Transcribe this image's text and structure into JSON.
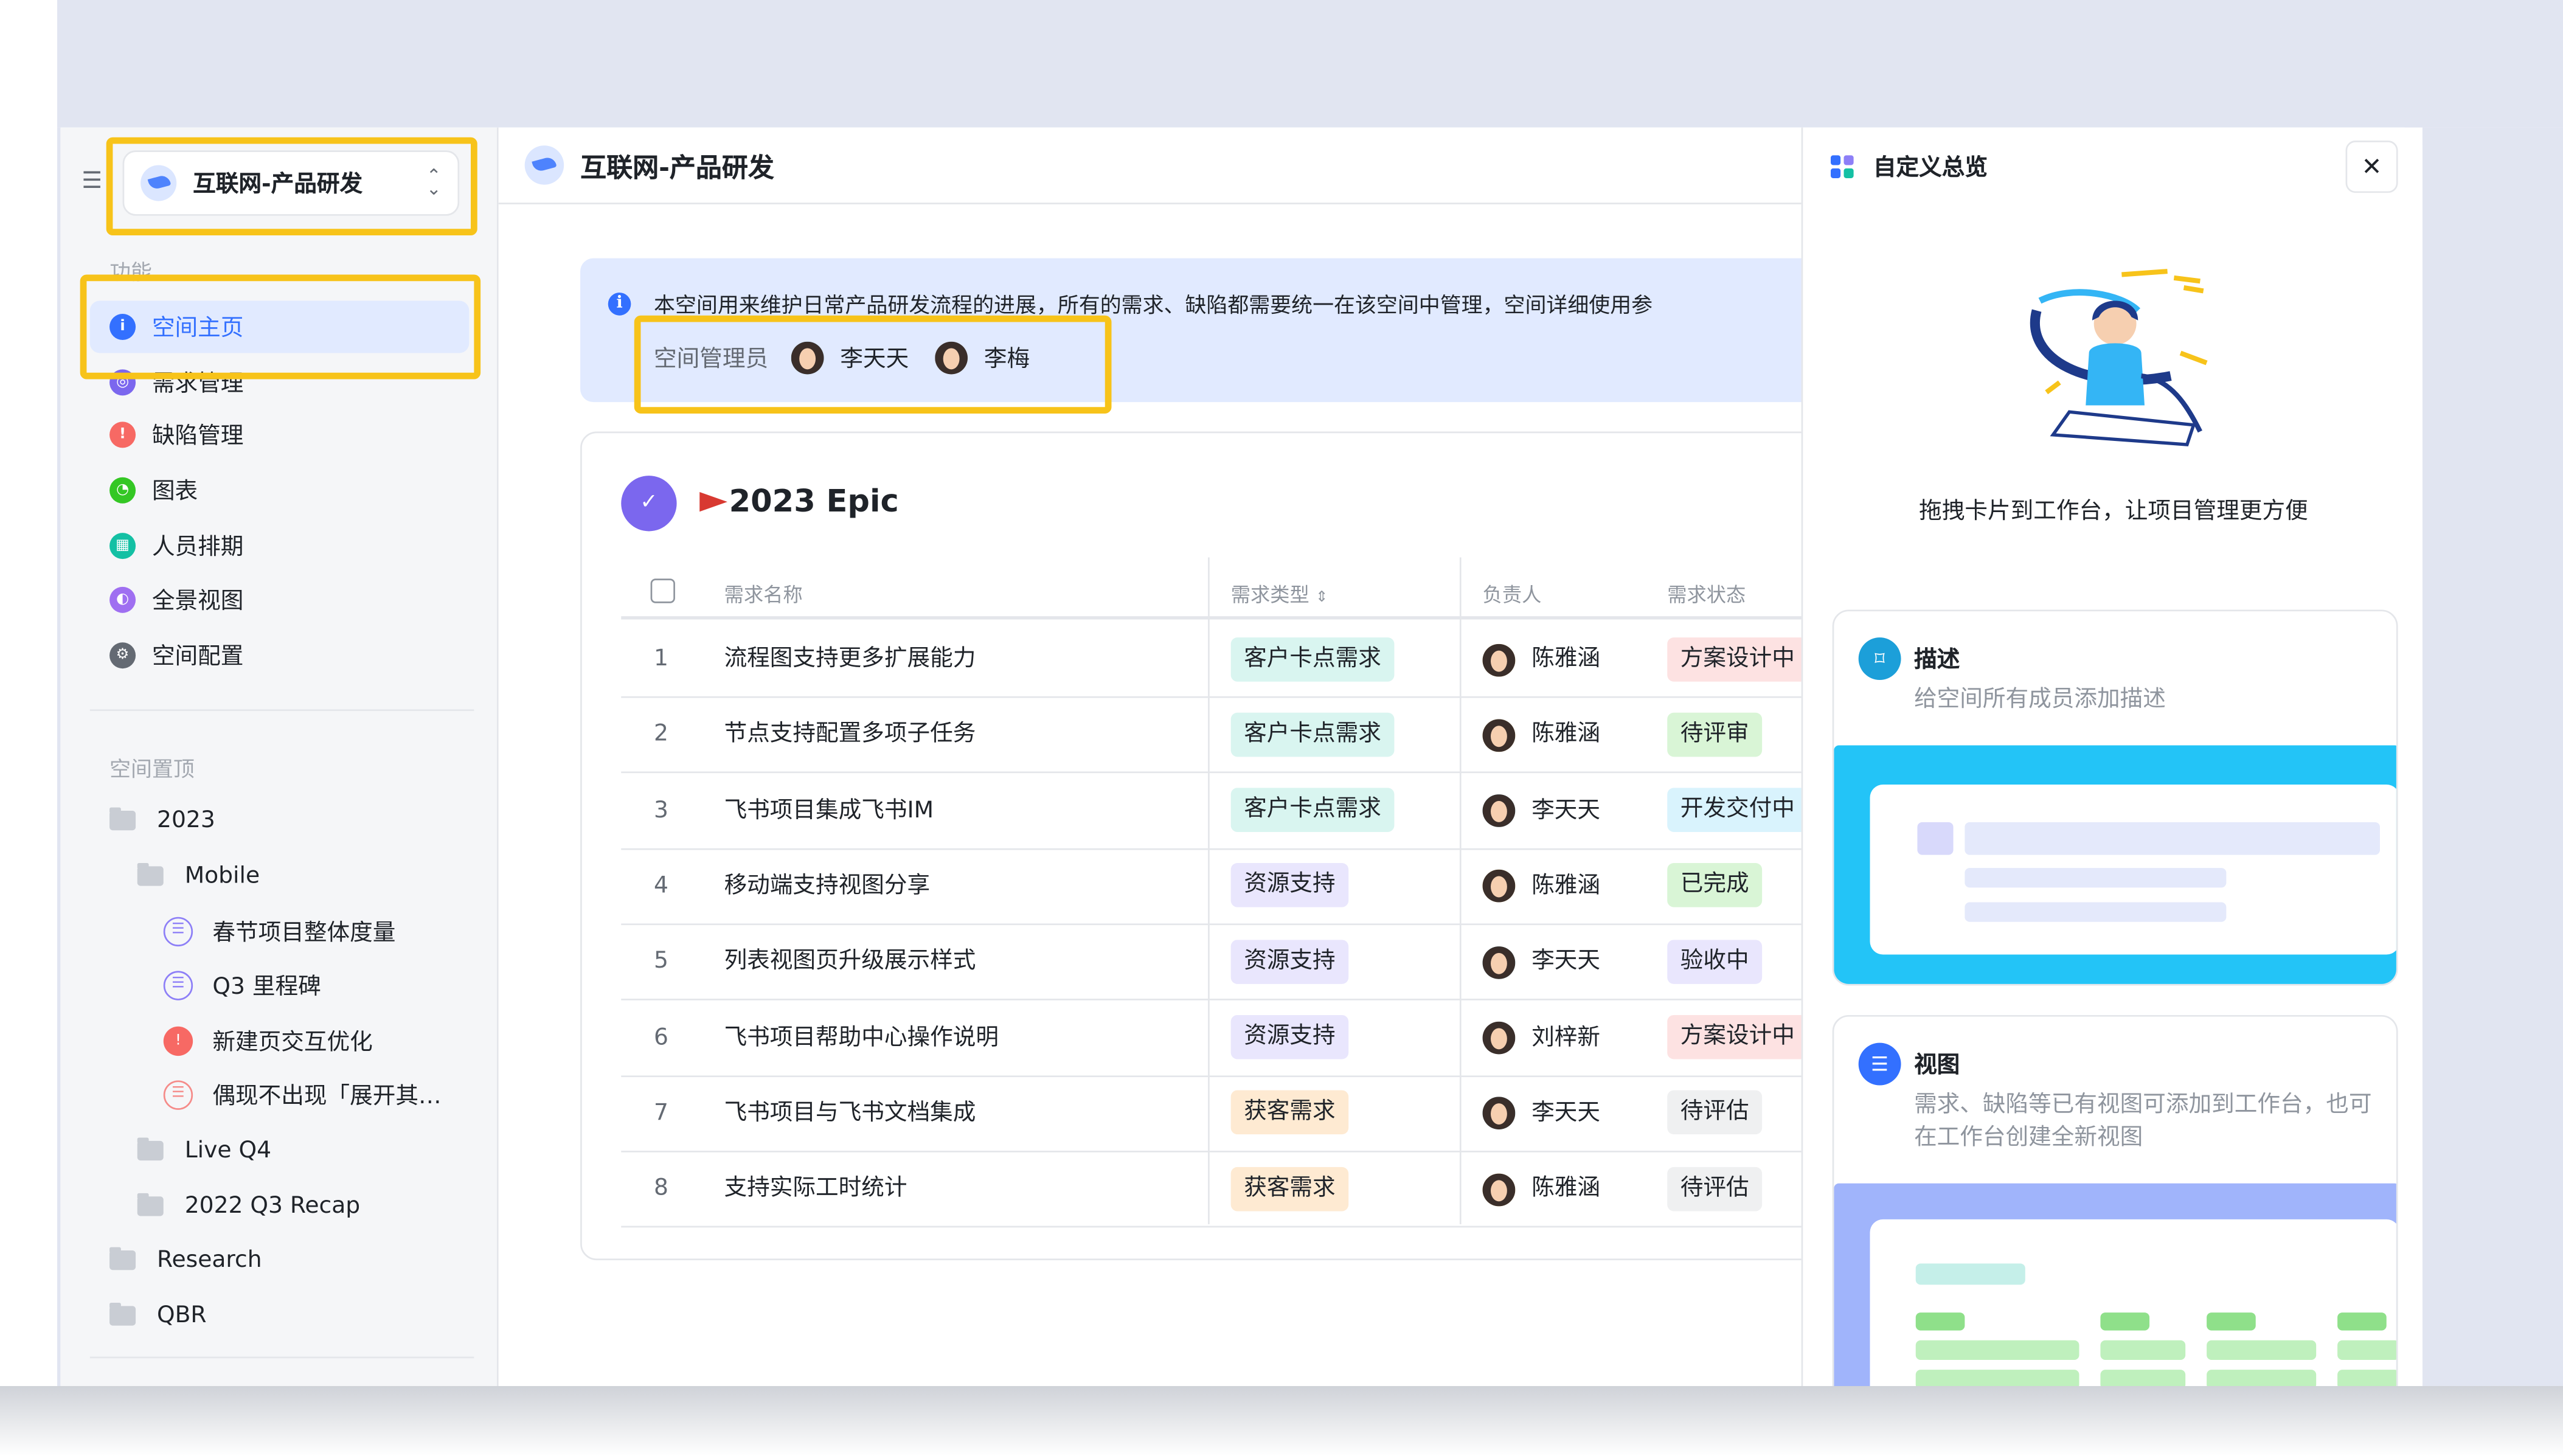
{
  "sidebar": {
    "space_name": "互联网-产品研发",
    "section_features": "功能",
    "nav": [
      {
        "label": "空间主页",
        "icon": "home-icon",
        "color": "#3370ff"
      },
      {
        "label": "需求管理",
        "icon": "requirement-icon",
        "color": "#7b67ee"
      },
      {
        "label": "缺陷管理",
        "icon": "bug-icon",
        "color": "#f76964"
      },
      {
        "label": "图表",
        "icon": "chart-icon",
        "color": "#34c724"
      },
      {
        "label": "人员排期",
        "icon": "schedule-icon",
        "color": "#14c0a4"
      },
      {
        "label": "全景视图",
        "icon": "panorama-icon",
        "color": "#9f6ff1"
      },
      {
        "label": "空间配置",
        "icon": "settings-icon",
        "color": "#646a73"
      }
    ],
    "section_pinned": "空间置顶",
    "tree": [
      {
        "label": "2023",
        "type": "folder"
      },
      {
        "label": "Mobile",
        "type": "folder"
      },
      {
        "label": "春节项目整体度量",
        "type": "view"
      },
      {
        "label": "Q3 里程碑",
        "type": "view"
      },
      {
        "label": "新建页交互优化",
        "type": "bug"
      },
      {
        "label": "偶现不出现「展开其…",
        "type": "view-pink"
      },
      {
        "label": "Live Q4",
        "type": "folder"
      },
      {
        "label": "2022 Q3 Recap",
        "type": "folder"
      },
      {
        "label": "Research",
        "type": "folder"
      },
      {
        "label": "QBR",
        "type": "folder"
      }
    ]
  },
  "main": {
    "title": "互联网-产品研发",
    "notice_text": "本空间用来维护日常产品研发流程的进展，所有的需求、缺陷都需要统一在该空间中管理，空间详细使用参",
    "admin_label": "空间管理员",
    "admins": [
      "李天天",
      "李梅"
    ],
    "epic_title": "2023 Epic",
    "columns": [
      "需求名称",
      "需求类型",
      "负责人",
      "需求状态"
    ],
    "rows": [
      {
        "idx": "1",
        "name": "流程图支持更多扩展能力",
        "type": "客户卡点需求",
        "owner": "陈雅涵",
        "status": "方案设计中"
      },
      {
        "idx": "2",
        "name": "节点支持配置多项子任务",
        "type": "客户卡点需求",
        "owner": "陈雅涵",
        "status": "待评审"
      },
      {
        "idx": "3",
        "name": "飞书项目集成飞书IM",
        "type": "客户卡点需求",
        "owner": "李天天",
        "status": "开发交付中"
      },
      {
        "idx": "4",
        "name": "移动端支持视图分享",
        "type": "资源支持",
        "owner": "陈雅涵",
        "status": "已完成"
      },
      {
        "idx": "5",
        "name": "列表视图页升级展示样式",
        "type": "资源支持",
        "owner": "李天天",
        "status": "验收中"
      },
      {
        "idx": "6",
        "name": "飞书项目帮助中心操作说明",
        "type": "资源支持",
        "owner": "刘梓新",
        "status": "方案设计中"
      },
      {
        "idx": "7",
        "name": "飞书项目与飞书文档集成",
        "type": "获客需求",
        "owner": "李天天",
        "status": "待评估"
      },
      {
        "idx": "8",
        "name": "支持实际工时统计",
        "type": "获客需求",
        "owner": "陈雅涵",
        "status": "待评估"
      }
    ]
  },
  "panel": {
    "title": "自定义总览",
    "close_label": "✕",
    "hint": "拖拽卡片到工作台，让项目管理更方便",
    "features": [
      {
        "title": "描述",
        "desc": "给空间所有成员添加描述",
        "icon": "bookmark-icon"
      },
      {
        "title": "视图",
        "desc": "需求、缺陷等已有视图可添加到工作台，也可在工作台创建全新视图",
        "icon": "list-icon"
      }
    ]
  },
  "colors": {
    "accent": "#3370ff",
    "highlight": "#f7c31a",
    "tag_teal_bg": "#d9f5f0",
    "tag_purple_bg": "#e9e6fd",
    "tag_orange_bg": "#feead2",
    "status_pink_bg": "#fde2e2",
    "status_green_bg": "#d9f5d6",
    "status_blue_bg": "#d9f3fd",
    "status_gray_bg": "#eff0f1"
  }
}
